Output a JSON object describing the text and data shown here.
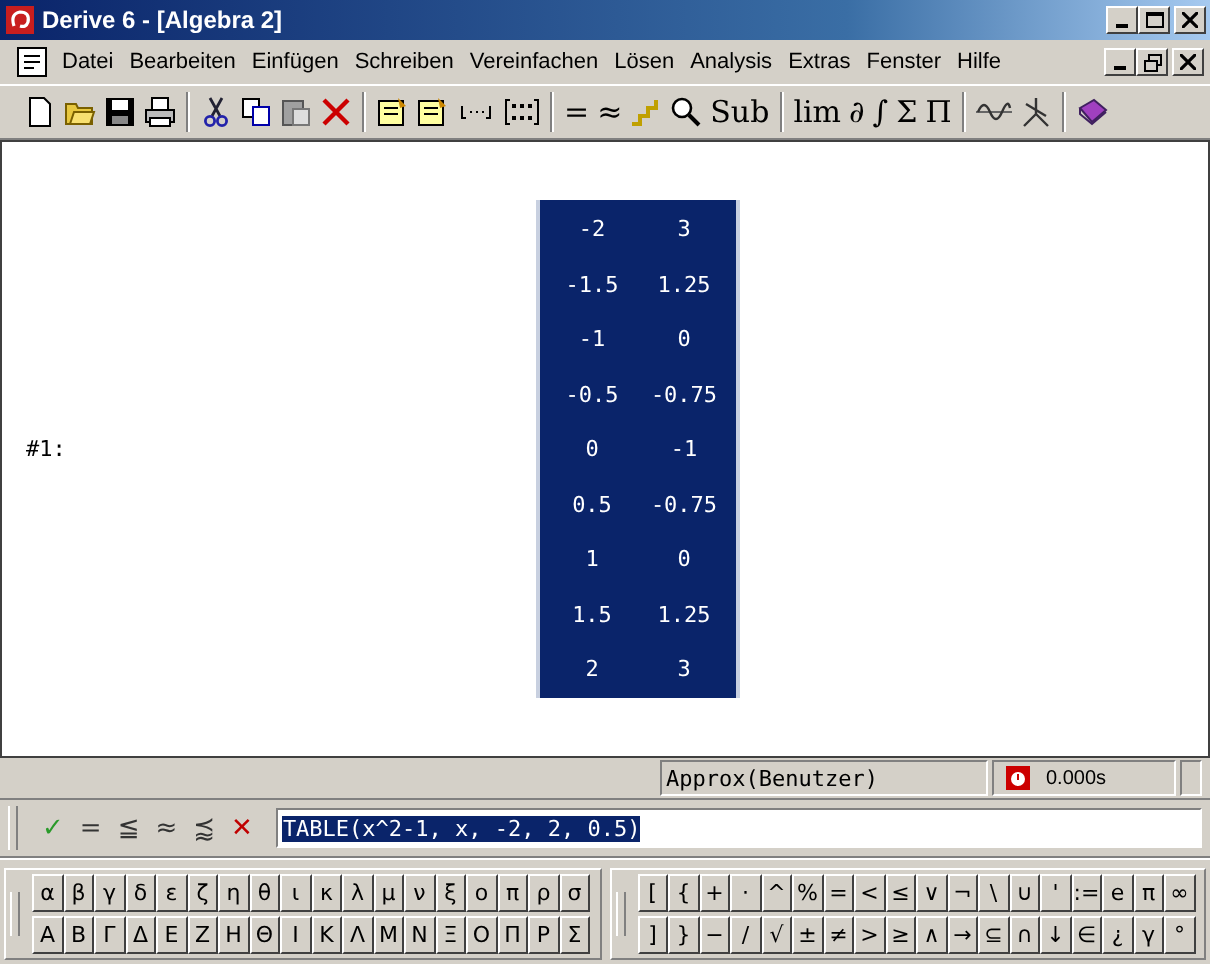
{
  "window": {
    "title": "Derive 6 - [Algebra 2]"
  },
  "menu": [
    "Datei",
    "Bearbeiten",
    "Einfügen",
    "Schreiben",
    "Vereinfachen",
    "Lösen",
    "Analysis",
    "Extras",
    "Fenster",
    "Hilfe"
  ],
  "toolbar": [
    {
      "kind": "new"
    },
    {
      "kind": "open"
    },
    {
      "kind": "save"
    },
    {
      "kind": "print"
    },
    {
      "kind": "sep"
    },
    {
      "kind": "cut"
    },
    {
      "kind": "copy"
    },
    {
      "kind": "paste"
    },
    {
      "kind": "delete"
    },
    {
      "kind": "sep"
    },
    {
      "kind": "note"
    },
    {
      "kind": "note"
    },
    {
      "kind": "vector"
    },
    {
      "kind": "matrix"
    },
    {
      "kind": "sep"
    },
    {
      "kind": "glyph",
      "label": "="
    },
    {
      "kind": "glyph",
      "label": "≈"
    },
    {
      "kind": "step"
    },
    {
      "kind": "zoom"
    },
    {
      "kind": "glyph",
      "label": "Sub"
    },
    {
      "kind": "sep"
    },
    {
      "kind": "glyph",
      "label": "lim"
    },
    {
      "kind": "glyph",
      "label": "∂"
    },
    {
      "kind": "glyph",
      "label": "∫"
    },
    {
      "kind": "glyph",
      "label": "Σ"
    },
    {
      "kind": "glyph",
      "label": "Π"
    },
    {
      "kind": "sep"
    },
    {
      "kind": "plot2d"
    },
    {
      "kind": "plot3d"
    },
    {
      "kind": "sep"
    },
    {
      "kind": "book"
    }
  ],
  "expression": {
    "label": "#1:",
    "selected": true,
    "rows": [
      [
        "-2",
        "3"
      ],
      [
        "-1.5",
        "1.25"
      ],
      [
        "-1",
        "0"
      ],
      [
        "-0.5",
        "-0.75"
      ],
      [
        "0",
        "-1"
      ],
      [
        "0.5",
        "-0.75"
      ],
      [
        "1",
        "0"
      ],
      [
        "1.5",
        "1.25"
      ],
      [
        "2",
        "3"
      ]
    ]
  },
  "status_bar": {
    "mode": "Approx(Benutzer)",
    "time": "0.000s"
  },
  "entry": {
    "buttons": [
      {
        "label": "✓",
        "kind": "ok"
      },
      {
        "label": "=",
        "kind": "plain"
      },
      {
        "label": "≦",
        "kind": "plain"
      },
      {
        "label": "≈",
        "kind": "plain"
      },
      {
        "label": "⪷",
        "kind": "plain"
      },
      {
        "label": "✕",
        "kind": "cancel"
      }
    ],
    "value": "TABLE(x^2-1, x, -2, 2, 0.5)",
    "selected": true
  },
  "greek_keys": [
    [
      "α",
      "β",
      "γ",
      "δ",
      "ε",
      "ζ",
      "η",
      "θ",
      "ι",
      "κ",
      "λ",
      "μ",
      "ν",
      "ξ",
      "ο",
      "π",
      "ρ",
      "σ"
    ],
    [
      "Α",
      "Β",
      "Γ",
      "Δ",
      "Ε",
      "Ζ",
      "Η",
      "Θ",
      "Ι",
      "Κ",
      "Λ",
      "Μ",
      "Ν",
      "Ξ",
      "Ο",
      "Π",
      "Ρ",
      "Σ"
    ]
  ],
  "math_keys": [
    [
      "[",
      "{",
      "+",
      "·",
      "^",
      "%",
      "=",
      "<",
      "≤",
      "∨",
      "¬",
      "\\",
      "∪",
      "'",
      ":=",
      "e",
      "π",
      "∞"
    ],
    [
      "]",
      "}",
      "−",
      "/",
      "√",
      "±",
      "≠",
      ">",
      "≥",
      "∧",
      "→",
      "⊆",
      "∩",
      "↓",
      "∈",
      "¿",
      "γ",
      "°"
    ]
  ]
}
